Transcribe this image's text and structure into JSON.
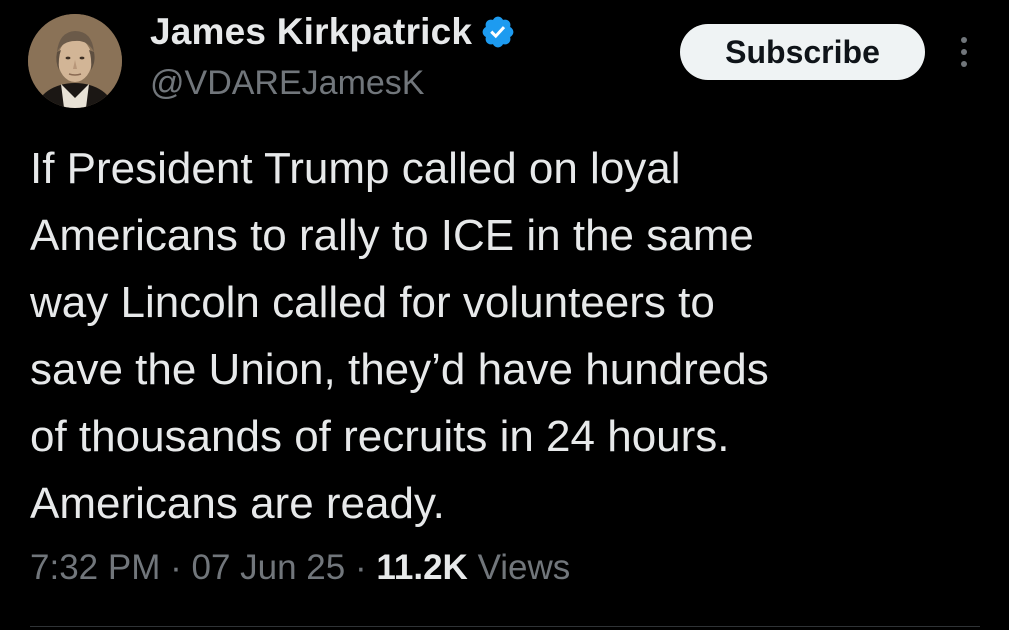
{
  "author": {
    "display_name": "James Kirkpatrick",
    "handle": "@VDAREJamesK",
    "verified_icon": "verified-badge-icon",
    "avatar_icon": "portrait-avatar"
  },
  "actions": {
    "subscribe_label": "Subscribe",
    "more_icon": "more-vertical-icon"
  },
  "tweet": {
    "lines": [
      "If President Trump called on loyal",
      "Americans to rally to ICE in the same",
      "way Lincoln called for volunteers to",
      "save the Union, they’d have hundreds",
      "of thousands of recruits in 24 hours.",
      "Americans are ready."
    ]
  },
  "meta": {
    "time": "7:32 PM",
    "separator": "·",
    "date": "07 Jun 25",
    "views_count": "11.2K",
    "views_label": "Views"
  },
  "colors": {
    "background": "#000000",
    "primary_text": "#e7e9ea",
    "secondary_text": "#71767b",
    "verified_blue": "#1d9bf0",
    "button_bg": "#eff3f4"
  }
}
